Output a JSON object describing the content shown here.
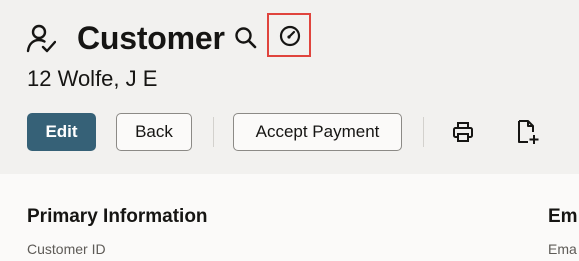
{
  "header": {
    "title": "Customer",
    "subtitle": "12 Wolfe, J E",
    "icons": {
      "record": "customer-record-icon",
      "search": "search-icon",
      "dashboard": "gauge-icon"
    },
    "highlight_color": "#e0443d"
  },
  "actions": {
    "edit_label": "Edit",
    "back_label": "Back",
    "accept_payment_label": "Accept Payment",
    "print_icon": "printer-icon",
    "new_doc_icon": "new-document-icon",
    "primary_color": "#366177"
  },
  "sections": {
    "primary": {
      "title": "Primary Information",
      "field_label": "Customer ID"
    },
    "secondary": {
      "title": "Em",
      "field_label": "Ema"
    }
  }
}
